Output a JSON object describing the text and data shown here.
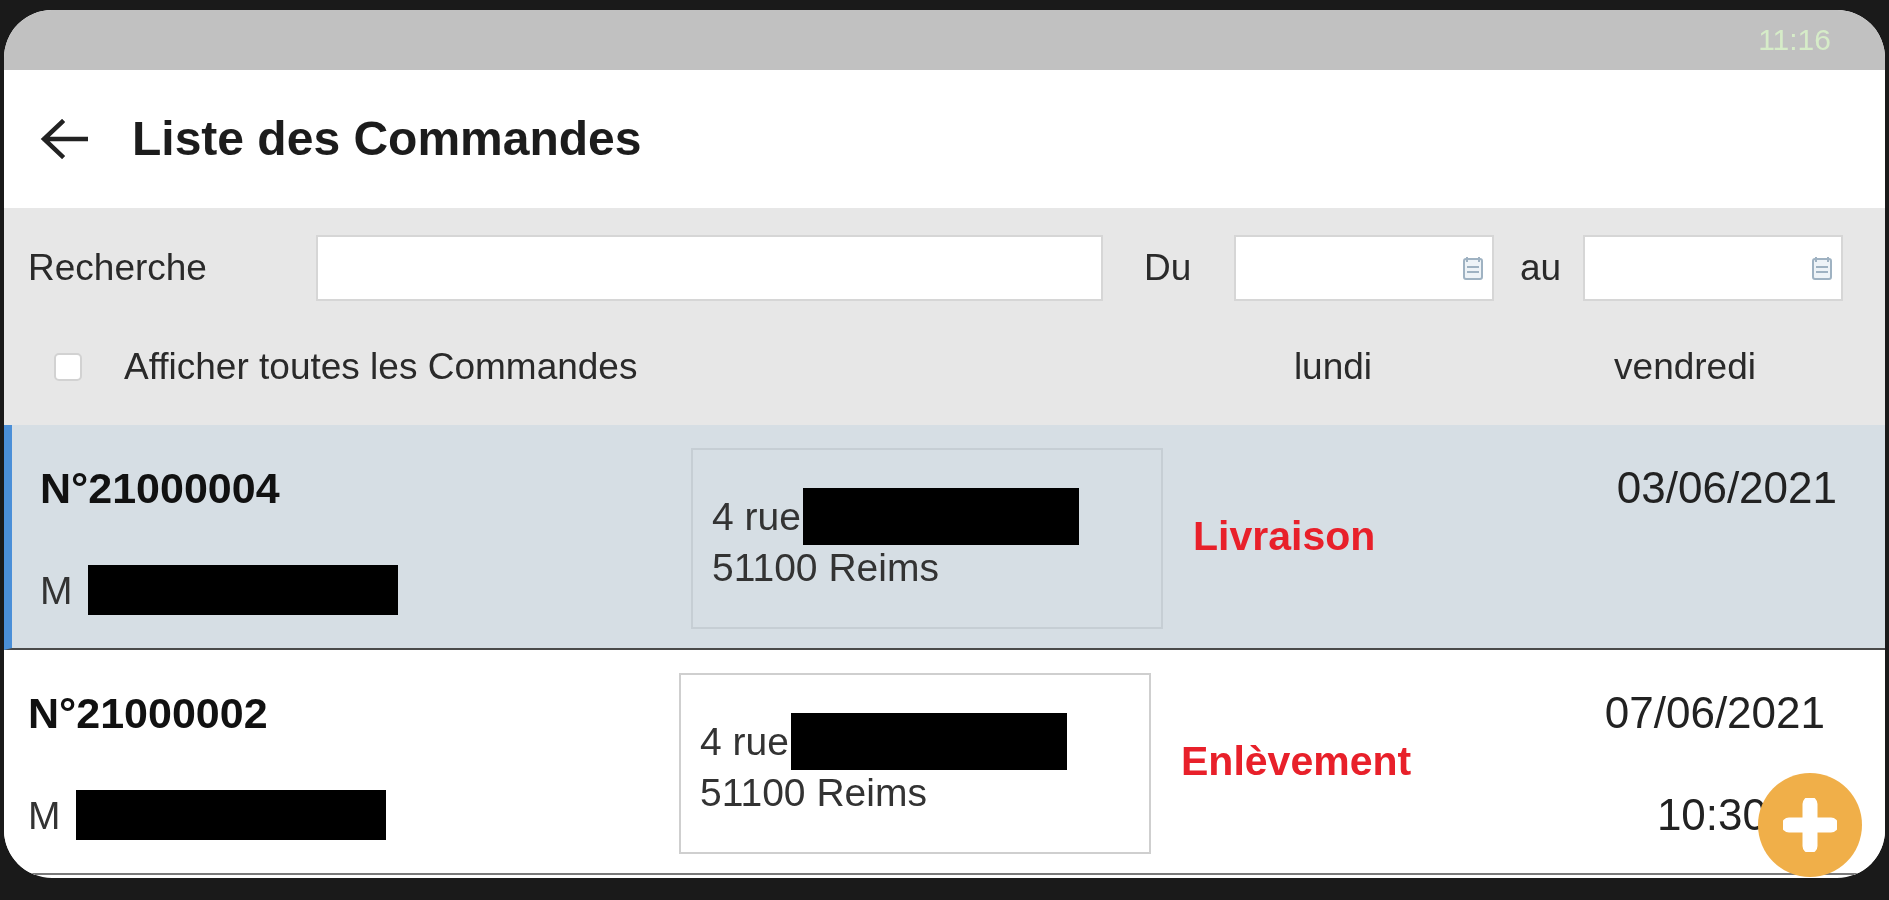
{
  "status_bar": {
    "time": "11:16"
  },
  "app_bar": {
    "title": "Liste des Commandes"
  },
  "filters": {
    "search_label": "Recherche",
    "from_label": "Du",
    "to_label": "au",
    "show_all": {
      "label": "Afficher toutes les Commandes",
      "checked": false
    },
    "from_day": "lundi",
    "to_day": "vendredi"
  },
  "orders": [
    {
      "number": "N°21000004",
      "customer": "M",
      "street": "4 rue",
      "city": "51100 Reims",
      "type": "Livraison",
      "date": "03/06/2021",
      "selected": true
    },
    {
      "number": "N°21000002",
      "customer": "M",
      "street": "4 rue",
      "city": "51100 Reims",
      "type": "Enlèvement",
      "date": "07/06/2021",
      "time": "10:30",
      "selected": false
    }
  ]
}
